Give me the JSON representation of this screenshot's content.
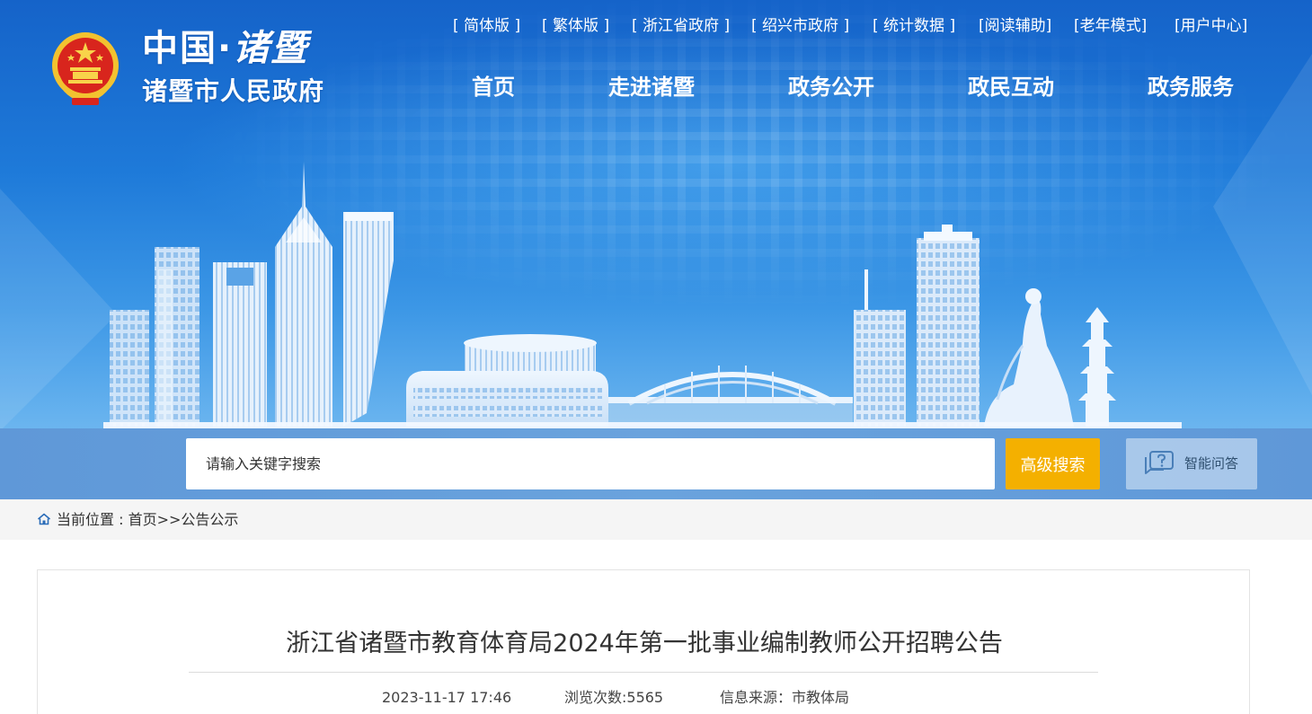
{
  "header": {
    "logo_top_1": "中国·",
    "logo_top_2": "诸暨",
    "logo_bottom": "诸暨市人民政府",
    "emblem_icon": "national-emblem-icon"
  },
  "top_links": [
    {
      "label": "[ 简体版 ]"
    },
    {
      "label": "[ 繁体版 ]"
    },
    {
      "label": "[ 浙江省政府 ]"
    },
    {
      "label": "[ 绍兴市政府 ]"
    },
    {
      "label": "[ 统计数据 ]"
    },
    {
      "label": "[阅读辅助]"
    },
    {
      "label": "[老年模式]"
    },
    {
      "label": "[用户中心]"
    }
  ],
  "nav": [
    {
      "label": "首页"
    },
    {
      "label": "走进诸暨"
    },
    {
      "label": "政务公开"
    },
    {
      "label": "政民互动"
    },
    {
      "label": "政务服务"
    }
  ],
  "search": {
    "placeholder": "请输入关键字搜索",
    "button_label": "高级搜索",
    "qa_label": "智能问答",
    "qa_icon": "chat-question-icon"
  },
  "breadcrumb": {
    "icon": "home-icon",
    "prefix": "当前位置 : ",
    "home": "首页",
    "separator": ">>",
    "current": "公告公示"
  },
  "article": {
    "title": "浙江省诸暨市教育体育局2024年第一批事业编制教师公开招聘公告",
    "date": "2023-11-17 17:46",
    "views": "浏览次数:5565",
    "source": "信息来源：市教体局"
  },
  "colors": {
    "banner_top": "#1563c9",
    "banner_bottom": "#6bb5ef",
    "search_button": "#f4b000",
    "breadcrumb_bg": "#f5f5f5"
  }
}
